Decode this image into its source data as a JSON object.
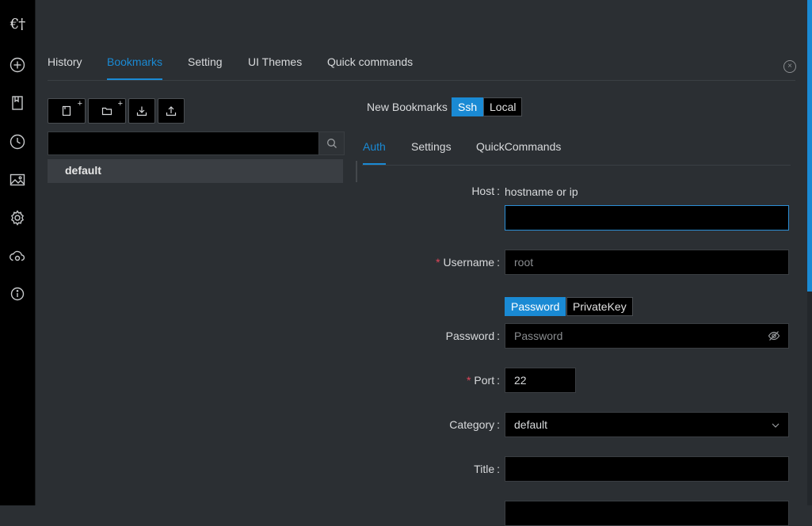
{
  "sidebar": {
    "logo": "€†",
    "items": [
      {
        "name": "new-tab-icon"
      },
      {
        "name": "bookmark-icon"
      },
      {
        "name": "history-clock-icon"
      },
      {
        "name": "image-icon"
      },
      {
        "name": "gear-icon"
      },
      {
        "name": "cloud-sync-icon"
      },
      {
        "name": "info-icon"
      }
    ]
  },
  "tabs": [
    {
      "label": "History"
    },
    {
      "label": "Bookmarks",
      "active": true
    },
    {
      "label": "Setting"
    },
    {
      "label": "UI Themes"
    },
    {
      "label": "Quick commands"
    }
  ],
  "close_symbol": "×",
  "toolbar": {
    "new_bookmark_plus": "+",
    "new_folder_plus": "+"
  },
  "search": {
    "value": "",
    "placeholder": ""
  },
  "tree": [
    {
      "label": "default"
    }
  ],
  "form": {
    "title": "New Bookmarks",
    "type_options": [
      {
        "label": "Ssh",
        "active": true
      },
      {
        "label": "Local",
        "active": false
      }
    ],
    "subtabs": [
      {
        "label": "Auth",
        "active": true
      },
      {
        "label": "Settings"
      },
      {
        "label": "QuickCommands"
      }
    ],
    "host": {
      "label": "Host",
      "hint": "hostname or ip",
      "value": ""
    },
    "username": {
      "label": "Username",
      "required": "*",
      "value": "",
      "placeholder": "root"
    },
    "auth_type": [
      {
        "label": "Password",
        "active": true
      },
      {
        "label": "PrivateKey",
        "active": false
      }
    ],
    "password": {
      "label": "Password",
      "value": "",
      "placeholder": "Password"
    },
    "port": {
      "label": "Port",
      "required": "*",
      "value": "22"
    },
    "category": {
      "label": "Category",
      "value": "default"
    },
    "title_field": {
      "label": "Title",
      "value": ""
    },
    "colon": ":"
  },
  "colors": {
    "accent": "#1a8ad4",
    "required": "#e0465a",
    "background": "#2b2f33",
    "input": "#000000"
  }
}
